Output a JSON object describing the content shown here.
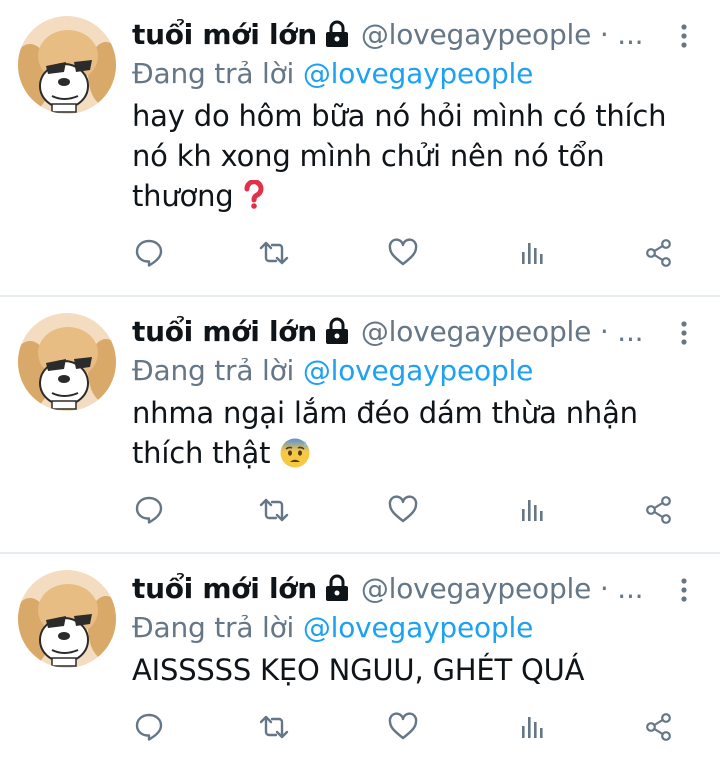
{
  "colors": {
    "accent": "#1da1f2",
    "secondary_text": "#657786",
    "primary_text": "#0f1419",
    "divider": "#e6ecf0"
  },
  "tweets": [
    {
      "display_name": "tuổi mới lớn",
      "handle": "@lovegaypeople · ...",
      "reply_prefix": "Đang trả lời",
      "reply_to": "@lovegaypeople",
      "text": "hay do hôm bữa nó hỏi mình có thích nó kh xong mình chửi nên nó tổn thương",
      "emoji": "red-question-mark-icon"
    },
    {
      "display_name": "tuổi mới lớn",
      "handle": "@lovegaypeople · ...",
      "reply_prefix": "Đang trả lời",
      "reply_to": "@lovegaypeople",
      "text": "nhma ngại lắm đéo dám thừa nhận thích thật",
      "emoji": "anxious-face-with-sweat-icon"
    },
    {
      "display_name": "tuổi mới lớn",
      "handle": "@lovegaypeople · ...",
      "reply_prefix": "Đang trả lời",
      "reply_to": "@lovegaypeople",
      "text": "AISSSSS KẸO NGUU, GHÉT QUÁ",
      "emoji": ""
    }
  ],
  "action_icons": [
    "reply-icon",
    "retweet-icon",
    "like-icon",
    "analytics-icon",
    "share-icon"
  ]
}
